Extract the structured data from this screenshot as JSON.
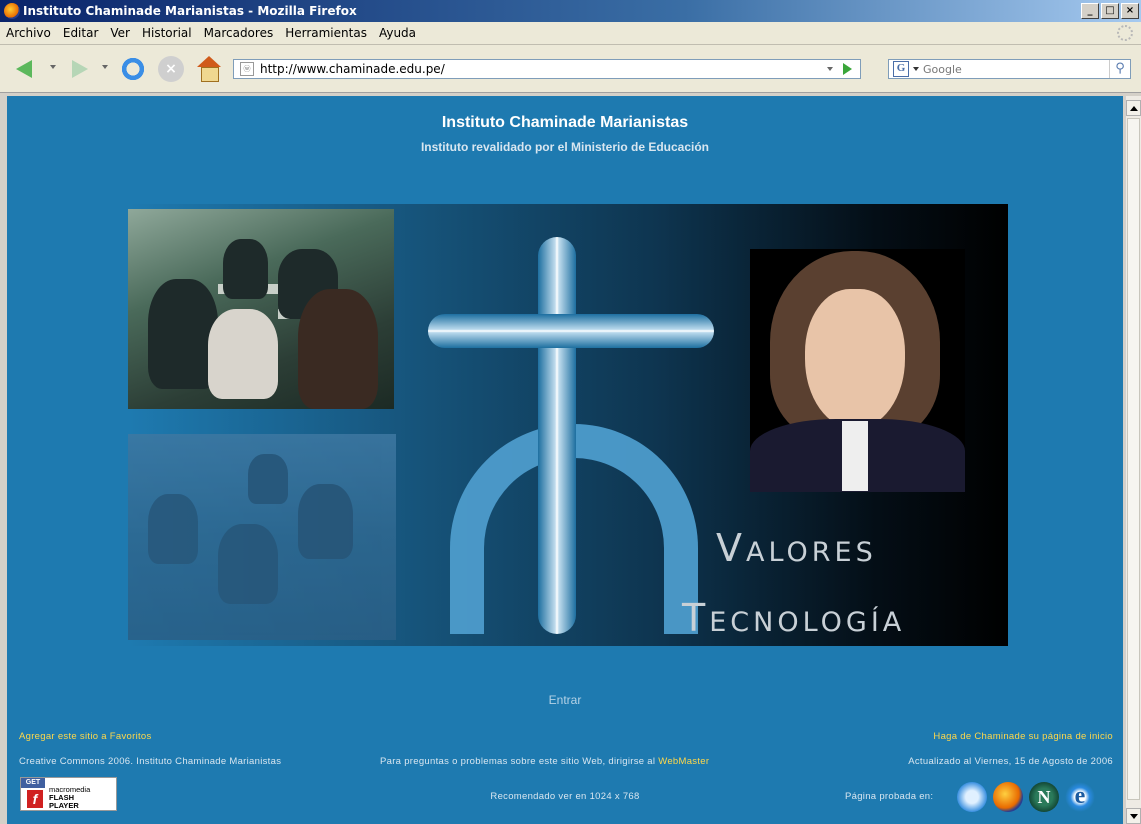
{
  "window": {
    "title": "Instituto Chaminade Marianistas - Mozilla Firefox",
    "controls": [
      "_",
      "□",
      "×"
    ]
  },
  "menu": [
    "Archivo",
    "Editar",
    "Ver",
    "Historial",
    "Marcadores",
    "Herramientas",
    "Ayuda"
  ],
  "nav": {
    "url": "http://www.chaminade.edu.pe/",
    "search_placeholder": "Google"
  },
  "page": {
    "title": "Instituto Chaminade Marianistas",
    "subtitle": "Instituto revalidado por el Ministerio de Educación",
    "banner_words": [
      "Valores",
      "Tecnología"
    ],
    "enter_link": "Entrar",
    "footer": {
      "add_favorites": "Agregar este sitio a Favoritos",
      "make_home": "Haga de Chaminade su página de inicio",
      "copyright": "Creative Commons 2006. Instituto Chaminade Marianistas",
      "questions_prefix": "Para preguntas o problemas sobre este sitio Web, dirigirse al ",
      "webmaster": "WebMaster",
      "updated": "Actualizado al Viernes, 15 de Agosto de 2006",
      "recommended": "Recomendado ver en 1024 x 768",
      "tested_in": "Página probada en:",
      "flash_badge": [
        "GET",
        "macromedia",
        "FLASH",
        "PLAYER"
      ]
    }
  },
  "colors": {
    "page_bg": "#1e7ab0",
    "link_yellow": "#ffd84a"
  },
  "icons": [
    "back-arrow-icon",
    "forward-arrow-icon",
    "reload-icon",
    "stop-icon",
    "home-icon",
    "search-icon",
    "safari-icon",
    "firefox-icon",
    "netscape-icon",
    "internet-explorer-icon"
  ]
}
